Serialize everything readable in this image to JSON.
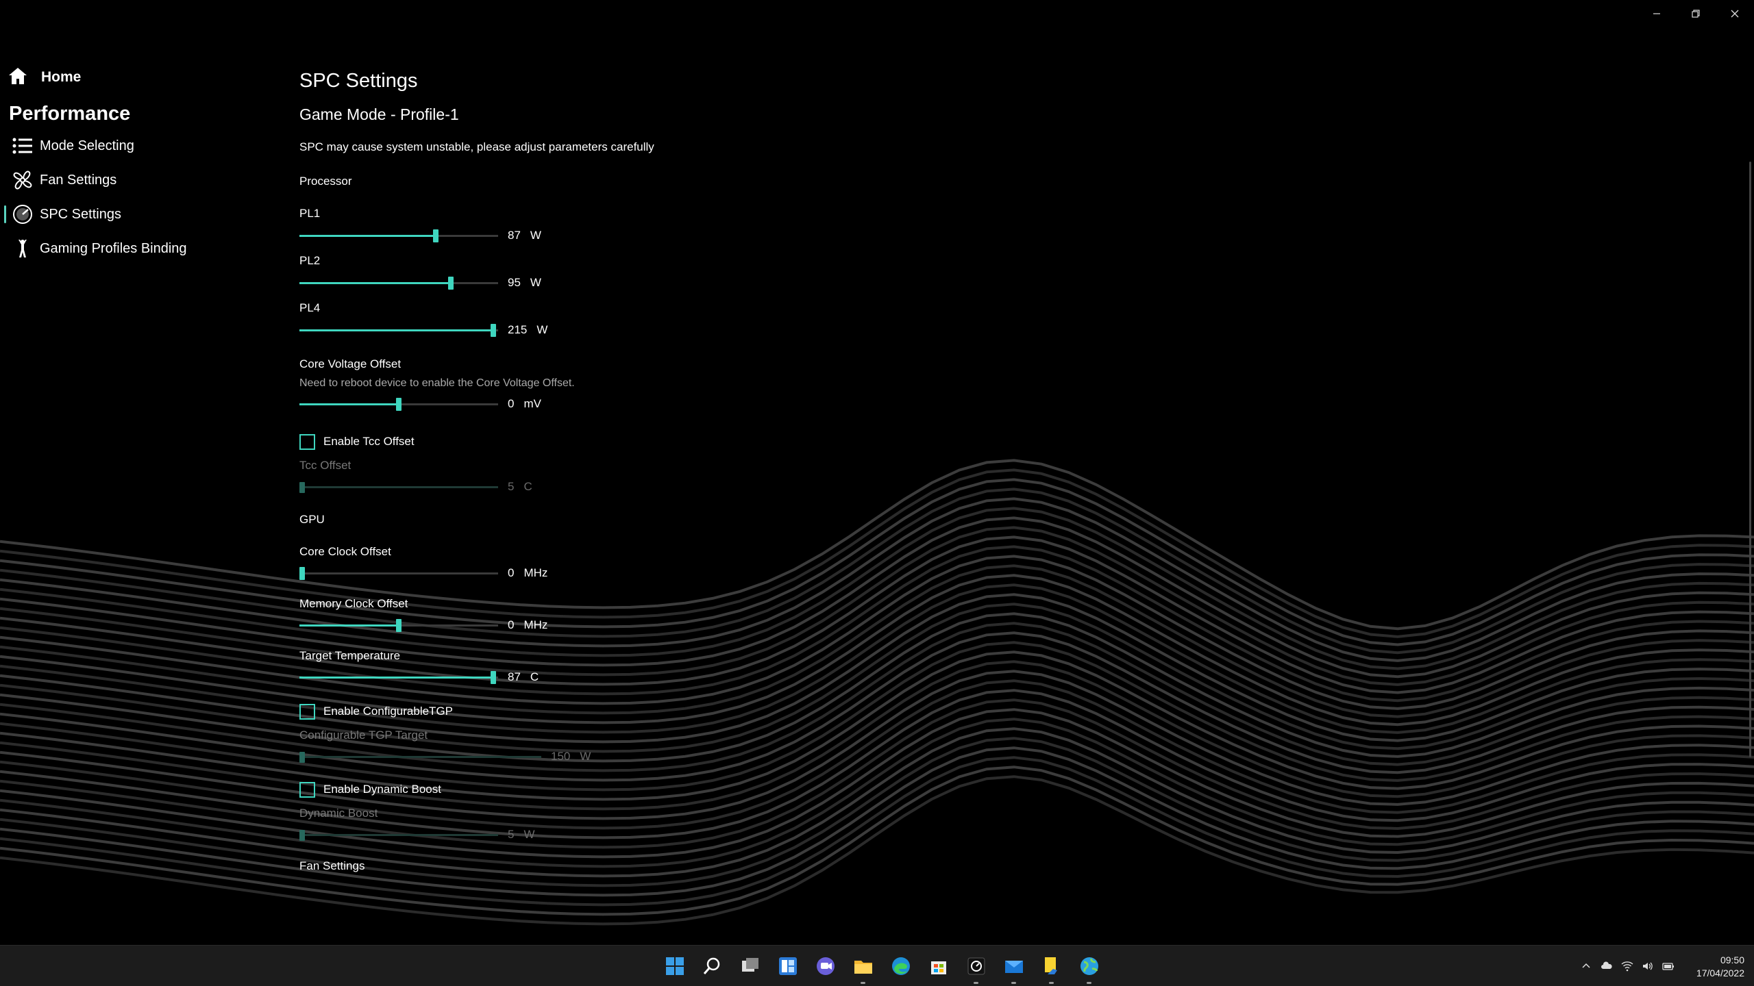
{
  "window": {
    "controls": [
      "minimize-icon",
      "restore-icon",
      "close-icon"
    ]
  },
  "sidebar": {
    "home": {
      "label": "Home",
      "icon": "home-icon"
    },
    "section": "Performance",
    "items": [
      {
        "label": "Mode Selecting",
        "icon": "list-icon"
      },
      {
        "label": "Fan Settings",
        "icon": "fan-icon"
      },
      {
        "label": "SPC Settings",
        "icon": "gauge-icon",
        "active": true
      },
      {
        "label": "Gaming Profiles Binding",
        "icon": "game-figure-icon"
      }
    ]
  },
  "main": {
    "title": "SPC Settings",
    "subtitle": "Game Mode - Profile-1",
    "warning": "SPC may cause system unstable, please adjust parameters carefully",
    "processor": {
      "label": "Processor",
      "pl1": {
        "label": "PL1",
        "value": "87",
        "unit": "W",
        "fraction": 0.69
      },
      "pl2": {
        "label": "PL2",
        "value": "95",
        "unit": "W",
        "fraction": 0.77
      },
      "pl4": {
        "label": "PL4",
        "value": "215",
        "unit": "W",
        "fraction": 0.99
      },
      "core_voltage": {
        "label": "Core Voltage Offset",
        "hint": "Need to reboot device to enable the Core Voltage Offset.",
        "value": "0",
        "unit": "mV",
        "fraction": 0.5
      },
      "tcc": {
        "checkbox_label": "Enable Tcc Offset",
        "checked": false,
        "label": "Tcc Offset",
        "value": "5",
        "unit": "C",
        "fraction": 0.0
      }
    },
    "gpu": {
      "label": "GPU",
      "core_clock": {
        "label": "Core Clock Offset",
        "value": "0",
        "unit": "MHz",
        "fraction": 0.0
      },
      "memory_clock": {
        "label": "Memory Clock Offset",
        "value": "0",
        "unit": "MHz",
        "fraction": 0.5
      },
      "target_temp": {
        "label": "Target Temperature",
        "value": "87",
        "unit": "C",
        "fraction": 0.99
      },
      "tgp": {
        "checkbox_label": "Enable ConfigurableTGP",
        "checked": false,
        "label": "Configurable TGP Target",
        "value": "150",
        "unit": "W",
        "fraction": 0.0
      },
      "dynamic_boost": {
        "checkbox_label": "Enable Dynamic Boost",
        "checked": false,
        "label": "Dynamic Boost",
        "value": "5",
        "unit": "W",
        "fraction": 0.0
      }
    },
    "next_section": "Fan Settings"
  },
  "colors": {
    "accent": "#3fd6bf",
    "accent_disabled": "#27685d",
    "background": "#000000",
    "taskbar": "#1c1c1c"
  },
  "taskbar": {
    "apps": [
      {
        "icon": "windows-start-icon",
        "running": false
      },
      {
        "icon": "search-icon",
        "running": false
      },
      {
        "icon": "task-view-icon",
        "running": false
      },
      {
        "icon": "widgets-icon",
        "running": false
      },
      {
        "icon": "chat-icon",
        "running": false
      },
      {
        "icon": "file-explorer-icon",
        "running": true
      },
      {
        "icon": "edge-browser-icon",
        "running": false
      },
      {
        "icon": "store-icon",
        "running": false
      },
      {
        "icon": "control-center-icon",
        "running": true
      },
      {
        "icon": "mail-icon",
        "running": true
      },
      {
        "icon": "sticky-notes-icon",
        "running": true
      },
      {
        "icon": "globe-app-icon",
        "running": true
      }
    ],
    "tray": [
      "chevron-up-icon",
      "cloud-icon",
      "wifi-icon",
      "volume-icon",
      "battery-icon"
    ],
    "time": "09:50",
    "date": "17/04/2022"
  }
}
